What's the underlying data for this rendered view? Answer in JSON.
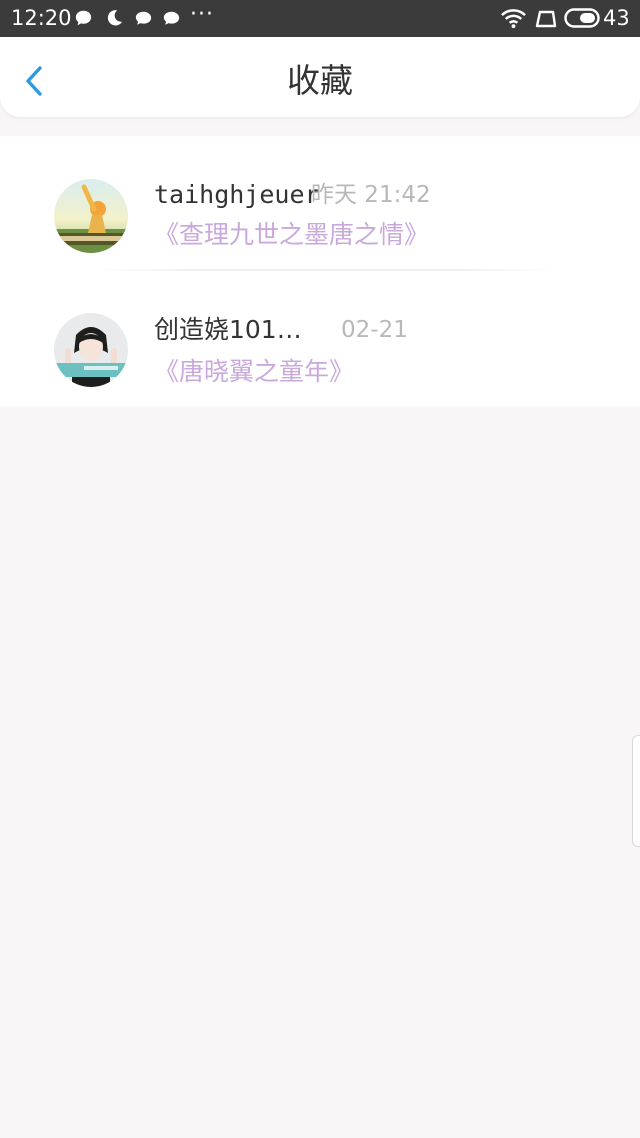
{
  "status_bar": {
    "time": "12:20",
    "more": "···",
    "battery_level": "43"
  },
  "header": {
    "title": "收藏",
    "back_icon": "chevron-left-icon",
    "accent_color": "#2b9ae3"
  },
  "favorites": [
    {
      "user": "taihghjeuer",
      "time": "昨天 21:42",
      "work": "《查理九世之墨唐之情》"
    },
    {
      "user": "创造娆101…",
      "time": "02-21",
      "work": "《唐晓翼之童年》"
    }
  ],
  "colors": {
    "background": "#f8f6f7",
    "work_title": "#c9a9dc",
    "timestamp": "#b8b8b8"
  }
}
